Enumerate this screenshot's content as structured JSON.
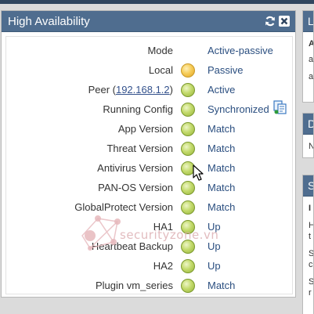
{
  "widget": {
    "title": "High Availability",
    "rows": [
      {
        "label": "Mode",
        "status": "",
        "value": "Active-passive"
      },
      {
        "label": "Local",
        "status": "passive",
        "value": "Passive"
      },
      {
        "label": "Peer (",
        "link": "192.168.1.2",
        "label_suffix": ")",
        "status": "ok",
        "value": "Active"
      },
      {
        "label": "Running Config",
        "status": "ok",
        "value": "Synchronized"
      },
      {
        "label": "App Version",
        "status": "ok",
        "value": "Match"
      },
      {
        "label": "Threat Version",
        "status": "ok",
        "value": "Match"
      },
      {
        "label": "Antivirus Version",
        "status": "ok",
        "value": "Match"
      },
      {
        "label": "PAN-OS Version",
        "status": "ok",
        "value": "Match"
      },
      {
        "label": "GlobalProtect Version",
        "status": "ok",
        "value": "Match"
      },
      {
        "label": "HA1",
        "status": "ok",
        "value": "Up"
      },
      {
        "label": "Heartbeat Backup",
        "status": "ok",
        "value": "Up"
      },
      {
        "label": "HA2",
        "status": "ok",
        "value": "Up"
      },
      {
        "label": "Plugin vm_series",
        "status": "ok",
        "value": "Match"
      }
    ]
  },
  "watermark": "securityzone.vn",
  "side_panels": [
    {
      "header": "L",
      "lines": [
        "A",
        "a",
        "a"
      ]
    },
    {
      "header": "D",
      "lines": [
        "N"
      ]
    },
    {
      "header": "S",
      "lines": [
        "I",
        "H",
        "t",
        "S",
        "c",
        "S",
        "r"
      ]
    }
  ],
  "colors": {
    "header_bg": "#4f6d8f",
    "status_ok": "#b5cf5b",
    "status_passive": "#f2c24e",
    "value_text": "#2b4f80"
  }
}
